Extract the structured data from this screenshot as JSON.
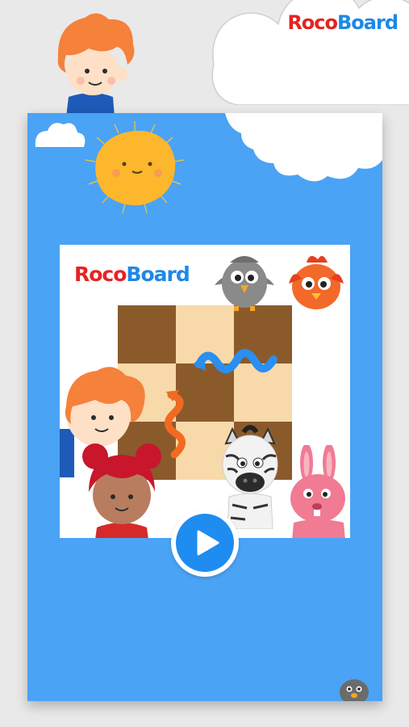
{
  "app": {
    "brand_part1": "Roco",
    "brand_part2": "Board"
  },
  "poster": {
    "brand_part1": "Roco",
    "brand_part2": "Board"
  },
  "colors": {
    "card_blue": "#4aa3f5",
    "board_dark": "#8b5a2b",
    "board_light": "#f7d9aa",
    "play_blue": "#1e8cf0",
    "brand_red": "#e52321",
    "brand_blue": "#1e88e5"
  },
  "icons": {
    "play": "play-icon"
  }
}
